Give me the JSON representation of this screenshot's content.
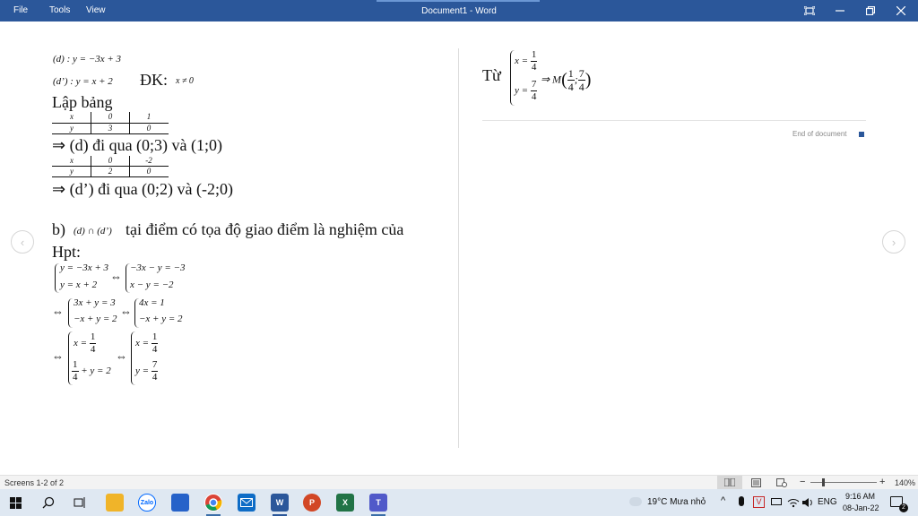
{
  "titlebar": {
    "menu": [
      "File",
      "Tools",
      "View"
    ],
    "title": "Document1 - Word"
  },
  "page1": {
    "line_d_label": "(d) : y = −3x + 3",
    "line_d2_label": "(d’) : y = x + 2",
    "dk_label": "ĐK:",
    "dk_cond": "x ≠ 0",
    "lap_bang": "Lập bảng",
    "table1": {
      "row_x": [
        "x",
        "0",
        "1"
      ],
      "row_y": [
        "y",
        "3",
        "0"
      ]
    },
    "d_passes": "⇒ (d) đi qua (0;3) và (1;0)",
    "table2": {
      "row_x": [
        "x",
        "0",
        "-2"
      ],
      "row_y": [
        "y",
        "2",
        "0"
      ]
    },
    "d2_passes": "⇒ (d’) đi qua (0;2) và (-2;0)",
    "part_b_prefix": "b)",
    "part_b_math": "(d) ∩ (d’)",
    "part_b_text": "tại điểm có tọa độ giao điểm là nghiệm của",
    "hpt": "Hpt:",
    "sys1": {
      "a1": "y = −3x + 3",
      "a2": "y = x + 2",
      "b1": "−3x − y = −3",
      "b2": "x − y = −2"
    },
    "sys2": {
      "a1": "3x + y = 3",
      "a2": "−x + y = 2",
      "b1": "4x = 1",
      "b2": "−x + y = 2"
    },
    "sys3": {
      "a1_lhs": "x =",
      "a1_num": "1",
      "a1_den": "4",
      "a2_num": "1",
      "a2_den": "4",
      "a2_rhs": "+ y = 2",
      "b1_lhs": "x =",
      "b1_num": "1",
      "b1_den": "4",
      "b2_lhs": "y =",
      "b2_num": "7",
      "b2_den": "4"
    },
    "implies": "⇔",
    "arrow": "⇔"
  },
  "page2": {
    "tu": "Từ",
    "x_lhs": "x =",
    "x_num": "1",
    "x_den": "4",
    "y_lhs": "y =",
    "y_num": "7",
    "y_den": "4",
    "result_prefix": "⇒ M",
    "m_x_num": "1",
    "m_x_den": "4",
    "m_sep": ";",
    "m_y_num": "7",
    "m_y_den": "4",
    "end_of_document": "End of document"
  },
  "statusbar": {
    "screens": "Screens 1-2 of 2",
    "zoom": "140%"
  },
  "taskbar": {
    "weather": "19°C  Mưa nhỏ",
    "lang": "ENG",
    "time": "9:16 AM",
    "date": "08-Jan-22",
    "notifications": "2",
    "zalo": "Zalo"
  },
  "colors": {
    "titlebar": "#2b579a",
    "taskbar": "#dfe8f2",
    "eod_marker": "#2b579a"
  }
}
